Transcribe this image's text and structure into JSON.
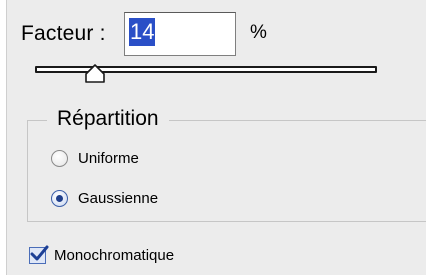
{
  "factor": {
    "label": "Facteur :",
    "value": "14",
    "unit": "%"
  },
  "slider": {
    "value_fraction": 0.18
  },
  "distribution": {
    "title": "Répartition",
    "options": [
      {
        "label": "Uniforme",
        "selected": false
      },
      {
        "label": "Gaussienne",
        "selected": true
      }
    ]
  },
  "monochromatic": {
    "label": "Monochromatique",
    "checked": true
  },
  "colors": {
    "panel": "#ececec",
    "selection": "#2a4fc7",
    "radio_dot": "#1f3f8c",
    "check_mark": "#1c3f95"
  },
  "icons": [
    "slider-thumb-icon",
    "radio-icon",
    "checkmark-icon"
  ]
}
